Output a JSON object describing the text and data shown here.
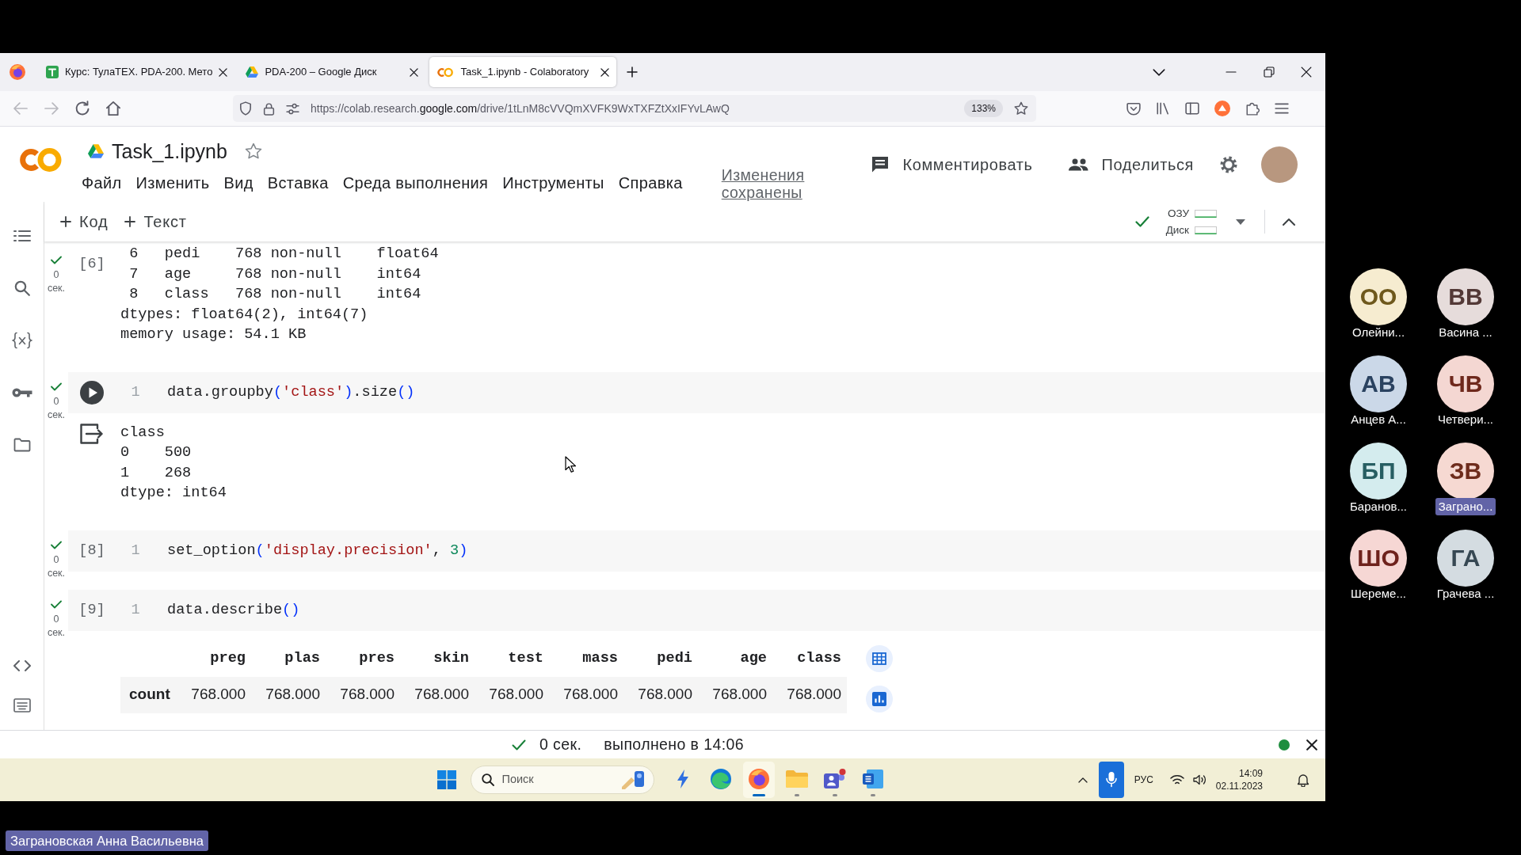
{
  "browser": {
    "tabs": [
      {
        "kind": "site",
        "title": "Курс: ТулаТЕХ. PDA-200. Мето",
        "selected": false
      },
      {
        "kind": "drive",
        "title": "PDA-200 – Google Диск",
        "selected": false
      },
      {
        "kind": "colab",
        "title": "Task_1.ipynb - Colaboratory",
        "selected": true
      }
    ],
    "can_go_back": false,
    "can_go_forward": false,
    "url": "https://colab.research.**google.com**/drive/1tLnM8cVVQmXVFK9WxTXFZtXxIFYvLAwQ",
    "zoom": "133%"
  },
  "notebook": {
    "title": "Task_1.ipynb",
    "starred": false,
    "menu": [
      "Файл",
      "Изменить",
      "Вид",
      "Вставка",
      "Среда выполнения",
      "Инструменты",
      "Справка"
    ],
    "save_status": "Изменения сохранены",
    "actions": [
      {
        "kind": "comment",
        "label": "Комментировать"
      },
      {
        "kind": "share",
        "label": "Поделиться"
      }
    ]
  },
  "toolbar": {
    "add_buttons": [
      "Код",
      "Текст"
    ],
    "connected": true,
    "resources": [
      "ОЗУ",
      "Диск"
    ]
  },
  "cells": [
    {
      "prompt": "[6]",
      "hovered": false,
      "status": {
        "done": true,
        "time": "0",
        "unit": "сек."
      },
      "output": {
        "kind": "text",
        "lines": [
          " 6   pedi    768 non-null    float64",
          " 7   age     768 non-null    int64",
          " 8   class   768 non-null    int64",
          "dtypes: float64(2), int64(7)",
          "memory usage: 54.1 KB"
        ]
      }
    },
    {
      "hovered": true,
      "status": {
        "done": true,
        "time": "0",
        "unit": "сек."
      },
      "code": {
        "line": "1",
        "tokens": [
          {
            "kind": "plain",
            "text": "data.groupby"
          },
          {
            "kind": "bracket",
            "text": "("
          },
          {
            "kind": "string",
            "text": "'class'"
          },
          {
            "kind": "bracket",
            "text": ")"
          },
          {
            "kind": "plain",
            "text": ".size"
          },
          {
            "kind": "bracket",
            "text": "()"
          }
        ]
      },
      "output": {
        "kind": "text",
        "lines": [
          "class",
          "0    500",
          "1    268",
          "dtype: int64"
        ]
      }
    },
    {
      "prompt": "[8]",
      "hovered": false,
      "status": {
        "done": true,
        "time": "0",
        "unit": "сек."
      },
      "code": {
        "line": "1",
        "tokens": [
          {
            "kind": "plain",
            "text": "set_option"
          },
          {
            "kind": "bracket",
            "text": "("
          },
          {
            "kind": "string",
            "text": "'display.precision'"
          },
          {
            "kind": "plain",
            "text": ", "
          },
          {
            "kind": "number",
            "text": "3"
          },
          {
            "kind": "bracket",
            "text": ")"
          }
        ]
      }
    },
    {
      "prompt": "[9]",
      "hovered": false,
      "status": {
        "done": true,
        "time": "0",
        "unit": "сек."
      },
      "code": {
        "line": "1",
        "tokens": [
          {
            "kind": "plain",
            "text": "data.describe"
          },
          {
            "kind": "bracket",
            "text": "()"
          }
        ]
      },
      "output": {
        "kind": "table",
        "columns": [
          "preg",
          "plas",
          "pres",
          "skin",
          "test",
          "mass",
          "pedi",
          "age",
          "class"
        ],
        "rows": [
          {
            "label": "count",
            "values": [
              "768.000",
              "768.000",
              "768.000",
              "768.000",
              "768.000",
              "768.000",
              "768.000",
              "768.000",
              "768.000"
            ]
          }
        ]
      }
    }
  ],
  "status_bar": {
    "success": true,
    "elapsed": "0 сек.",
    "message": "выполнено в 14:06",
    "connected": true
  },
  "taskbar": {
    "search": {
      "placeholder": "Поиск"
    },
    "apps": [
      {
        "kind": "bolt",
        "running": false,
        "active": false
      },
      {
        "kind": "edge",
        "running": false,
        "active": false
      },
      {
        "kind": "firefox",
        "running": true,
        "active": true
      },
      {
        "kind": "folder",
        "running": true,
        "active": false
      },
      {
        "kind": "teams",
        "running": true,
        "active": false
      },
      {
        "kind": "word",
        "running": true,
        "active": false
      }
    ],
    "language": "РУС",
    "time": "14:09",
    "date": "02.11.2023"
  },
  "participants": [
    {
      "initials": "ОО",
      "name": "Олейни...",
      "color": "#f6ecd0",
      "highlighted": false
    },
    {
      "initials": "ВВ",
      "name": "Васина ...",
      "color": "#e6dcdb",
      "highlighted": false
    },
    {
      "initials": "АВ",
      "name": "Анцев А...",
      "color": "#cbd8e8",
      "highlighted": false
    },
    {
      "initials": "ЧВ",
      "name": "Четвери...",
      "color": "#f4d7d2",
      "highlighted": false
    },
    {
      "initials": "БП",
      "name": "Баранов...",
      "color": "#d4ecee",
      "highlighted": false
    },
    {
      "initials": "ЗВ",
      "name": "Заграно...",
      "color": "#f6d9d2",
      "highlighted": true
    },
    {
      "initials": "ШО",
      "name": "Шереме...",
      "color": "#f6d7d4",
      "highlighted": false
    },
    {
      "initials": "ГА",
      "name": "Грачева ...",
      "color": "#d4dce1",
      "highlighted": false
    }
  ],
  "speaker": "Заграновская Анна Васильевна"
}
